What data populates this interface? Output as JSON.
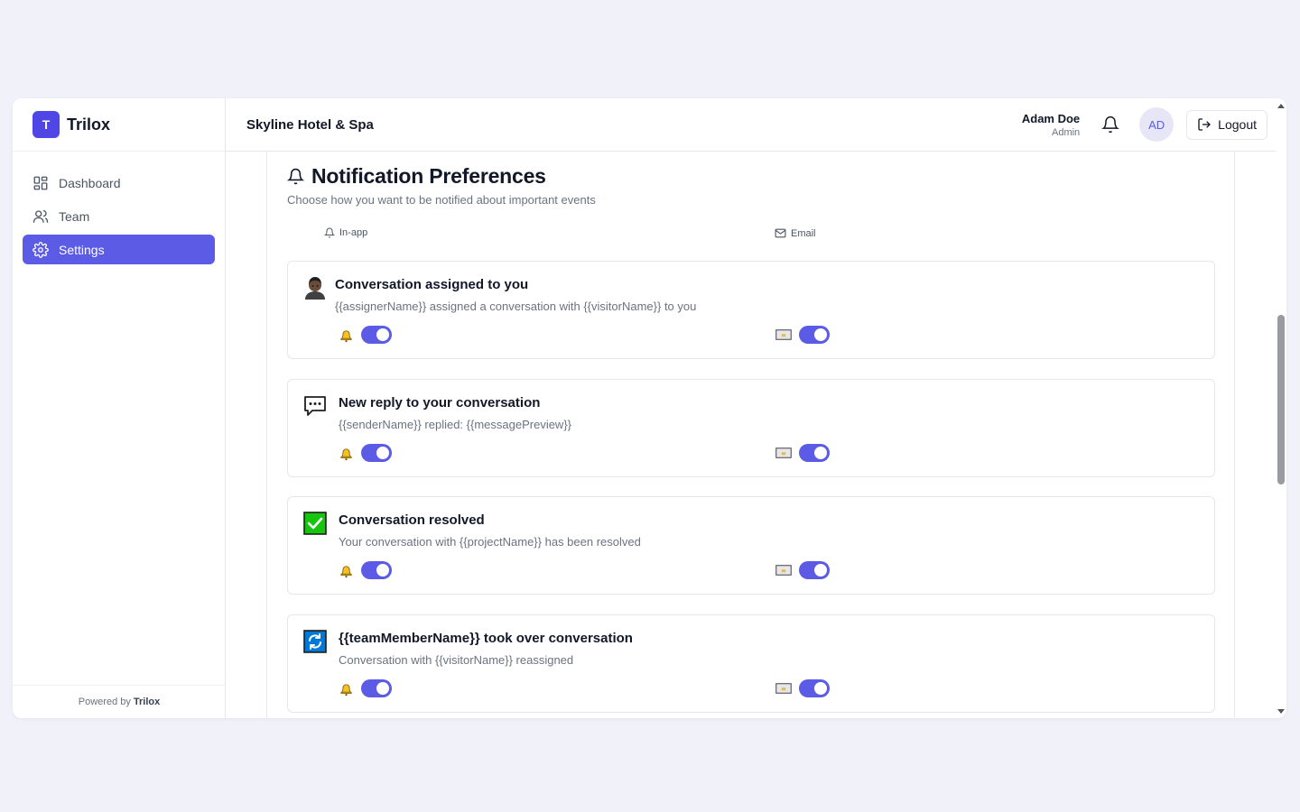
{
  "brand": {
    "logo_letter": "T",
    "name": "Trilox"
  },
  "sidebar": {
    "items": [
      {
        "label": "Dashboard",
        "icon": "dashboard-grid-icon",
        "active": false
      },
      {
        "label": "Team",
        "icon": "users-icon",
        "active": false
      },
      {
        "label": "Settings",
        "icon": "gear-icon",
        "active": true
      }
    ],
    "footer_prefix": "Powered by",
    "footer_brand": "Trilox"
  },
  "header": {
    "hotel_name": "Skyline Hotel & Spa",
    "user_name": "Adam Doe",
    "user_role": "Admin",
    "avatar_initials": "AD",
    "logout_label": "Logout"
  },
  "main": {
    "title": "Notification Preferences",
    "subtitle": "Choose how you want to be notified about important events",
    "columns": {
      "inapp": "In-app",
      "email": "Email"
    },
    "notifications": [
      {
        "title": "Conversation assigned to you",
        "description": "{{assignerName}} assigned a conversation with {{visitorName}} to you",
        "icon": "person-emoji-icon",
        "inapp_enabled": true,
        "email_enabled": true
      },
      {
        "title": "New reply to your conversation",
        "description": "{{senderName}} replied: {{messagePreview}}",
        "icon": "speech-bubble-icon",
        "inapp_enabled": true,
        "email_enabled": true
      },
      {
        "title": "Conversation resolved",
        "description": "Your conversation with {{projectName}} has been resolved",
        "icon": "check-box-icon",
        "inapp_enabled": true,
        "email_enabled": true
      },
      {
        "title": "{{teamMemberName}} took over conversation",
        "description": "Conversation with {{visitorName}} reassigned",
        "icon": "refresh-arrows-icon",
        "inapp_enabled": true,
        "email_enabled": true
      }
    ]
  },
  "colors": {
    "accent": "#5b5be6",
    "background": "#f1f1f9",
    "success": "#16c60c",
    "info": "#0078d7"
  }
}
